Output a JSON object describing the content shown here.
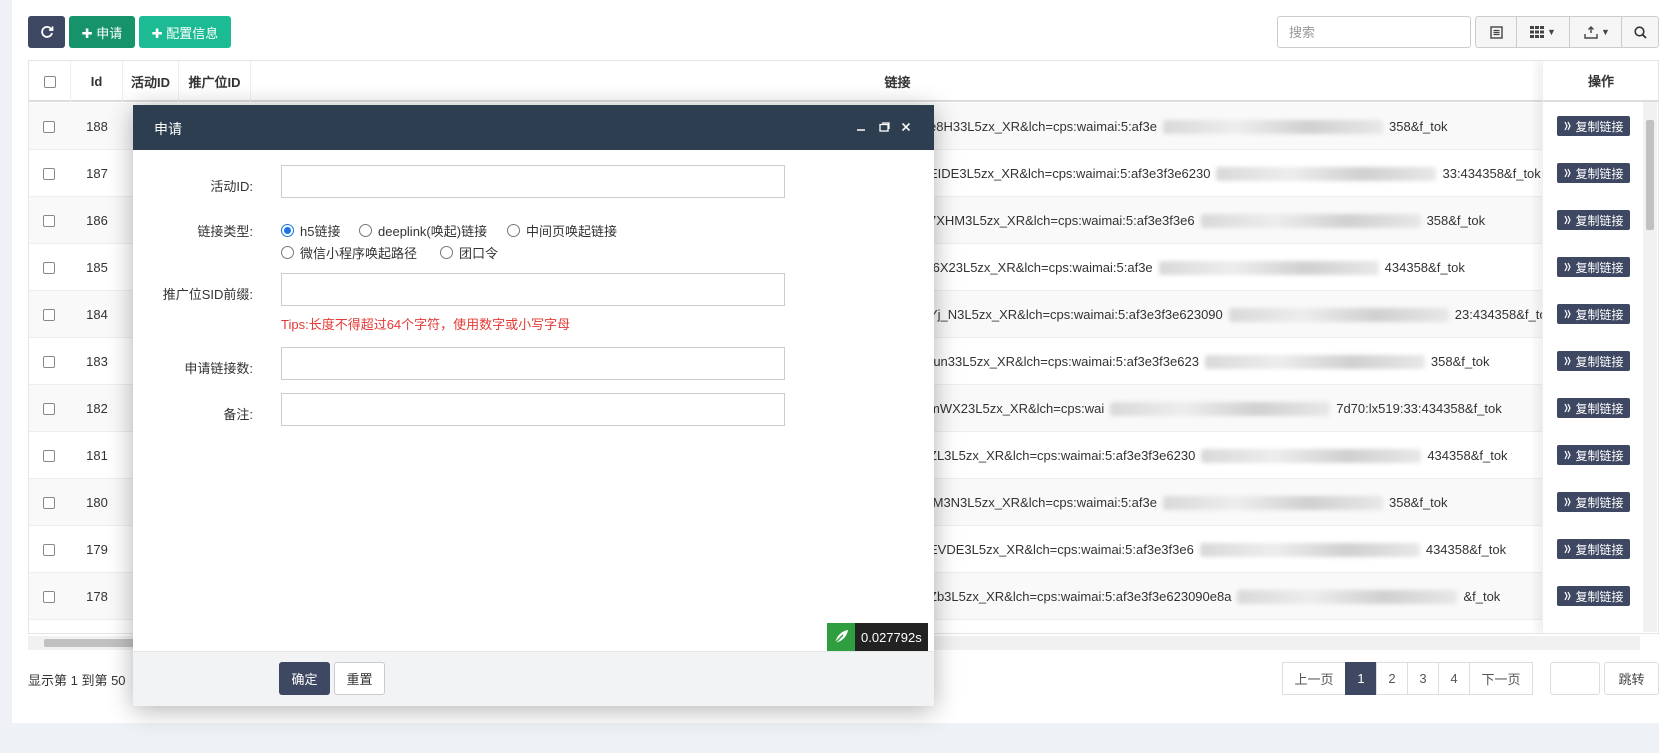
{
  "toolbar": {
    "refresh_icon": "refresh-icon",
    "apply_label": "✚ 申请",
    "config_label": "✚ 配置信息",
    "search_placeholder": "搜索"
  },
  "table": {
    "headers": {
      "id": "Id",
      "activity_id": "活动ID",
      "position_id": "推广位ID",
      "link": "链接",
      "ops": "操作"
    },
    "rows": [
      {
        "id": "188",
        "link_start": "e8H33L5zx_XR&lch=cps:waimai:5:af3e",
        "link_end": "358&f_tok"
      },
      {
        "id": "187",
        "link_start": "EIDE3L5zx_XR&lch=cps:waimai:5:af3e3f3e6230",
        "link_end": "33:434358&f_tok"
      },
      {
        "id": "186",
        "link_start": "7XHM3L5zx_XR&lch=cps:waimai:5:af3e3f3e6",
        "link_end": "358&f_tok"
      },
      {
        "id": "185",
        "link_start": "t6X23L5zx_XR&lch=cps:waimai:5:af3e",
        "link_end": "434358&f_tok"
      },
      {
        "id": "184",
        "link_start": "Yj_N3L5zx_XR&lch=cps:waimai:5:af3e3f3e623090",
        "link_end": "23:434358&f_tok"
      },
      {
        "id": "183",
        "link_start": "run33L5zx_XR&lch=cps:waimai:5:af3e3f3e623",
        "link_end": "358&f_tok"
      },
      {
        "id": "182",
        "link_start": "mWX23L5zx_XR&lch=cps:wai",
        "link_end": "7d70:lx519:33:434358&f_tok"
      },
      {
        "id": "181",
        "link_start": "ZL3L5zx_XR&lch=cps:waimai:5:af3e3f3e6230",
        "link_end": "434358&f_tok"
      },
      {
        "id": "180",
        "link_start": "tM3N3L5zx_XR&lch=cps:waimai:5:af3e",
        "link_end": "358&f_tok"
      },
      {
        "id": "179",
        "link_start": "EVDE3L5zx_XR&lch=cps:waimai:5:af3e3f3e6",
        "link_end": "434358&f_tok"
      },
      {
        "id": "178",
        "link_start": "Zb3L5zx_XR&lch=cps:waimai:5:af3e3f3e623090e8a",
        "link_end": "&f_tok"
      }
    ],
    "copy_label": "复制链接"
  },
  "footer": {
    "info": "显示第 1 到第 50",
    "pages": [
      "上一页",
      "1",
      "2",
      "3",
      "4",
      "下一页"
    ],
    "active_page": "1",
    "jump_label": "跳转"
  },
  "modal": {
    "title": "申请",
    "activity_label": "活动ID:",
    "link_type_label": "链接类型:",
    "link_types": [
      "h5链接",
      "deeplink(唤起)链接",
      "中间页唤起链接",
      "微信小程序唤起路径",
      "团口令"
    ],
    "selected_link_type": "h5链接",
    "sid_label": "推广位SID前缀:",
    "tips": "Tips:长度不得超过64个字符，使用数字或小写字母",
    "count_label": "申请链接数:",
    "remark_label": "备注:",
    "ok_label": "确定",
    "reset_label": "重置",
    "timer": "0.027792s"
  },
  "colors": {
    "primary": "#3f4863",
    "green": "#16936b",
    "teal": "#1dbb94",
    "title_bar": "#2c3e50",
    "tips": "#e53935"
  }
}
